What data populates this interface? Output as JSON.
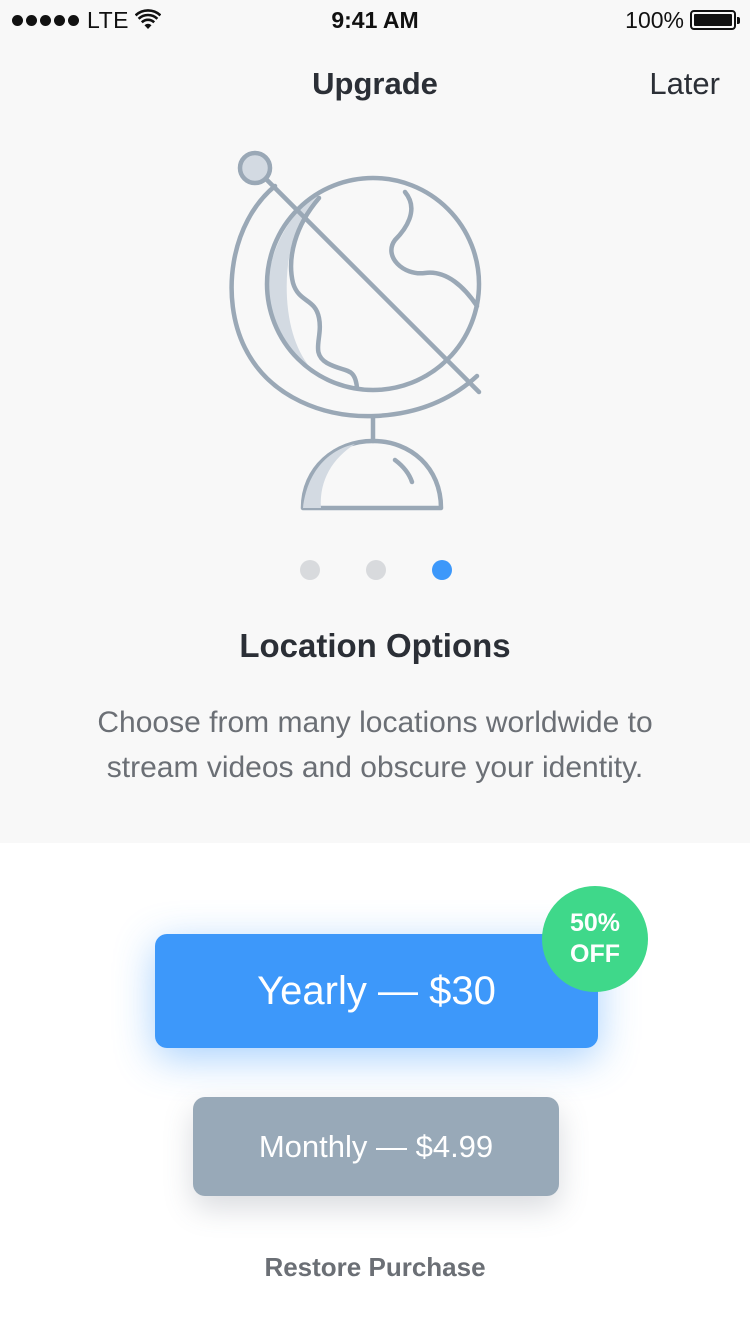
{
  "status_bar": {
    "carrier": "LTE",
    "time": "9:41 AM",
    "battery": "100%"
  },
  "nav": {
    "title": "Upgrade",
    "later_label": "Later"
  },
  "onboarding": {
    "illustration_icon": "globe-icon",
    "page_count": 3,
    "active_page": 3,
    "title": "Location Options",
    "description_line1": "Choose from many locations worldwide to",
    "description_line2": "stream videos and obscure your identity."
  },
  "plans": {
    "yearly_label": "Yearly — $30",
    "badge_line1": "50%",
    "badge_line2": "OFF",
    "monthly_label": "Monthly — $4.99",
    "restore_label": "Restore Purchase"
  },
  "colors": {
    "accent": "#3d98fa",
    "badge": "#3fd88a",
    "secondary_button": "#98a9b8",
    "illustration_stroke": "#9aa8b6"
  }
}
